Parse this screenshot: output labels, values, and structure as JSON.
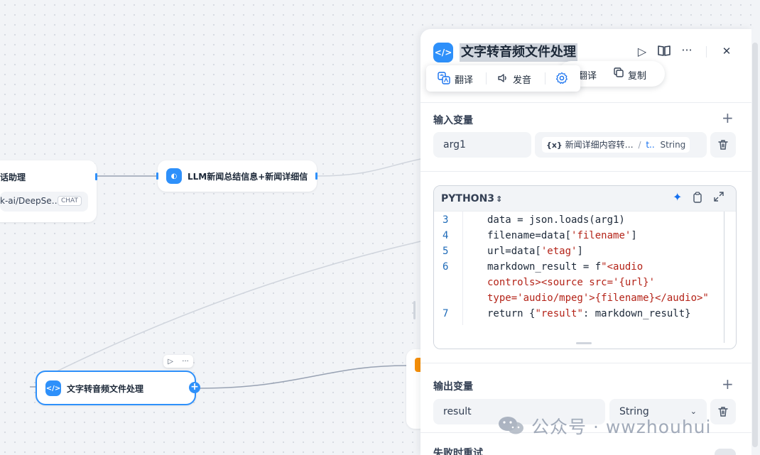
{
  "canvas": {
    "node_left": {
      "title": "话助理",
      "model": "k-ai/DeepSe…",
      "badge": "CHAT"
    },
    "node_llm": {
      "title": "LLM新闻总结信息+新闻详细信",
      "icon": "llm-icon"
    },
    "node_code": {
      "title": "文字转音频文件处理",
      "icon": "code-icon"
    },
    "mini_toolbar": {
      "run": "▷",
      "more": "···"
    },
    "plus": "+"
  },
  "panel": {
    "title": "文字转音频文件处理",
    "icon": "</>",
    "header_buttons": {
      "run": "▷",
      "docs": "📖",
      "more": "···",
      "close": "✕"
    },
    "input_section": {
      "label": "输入变量",
      "add": "+",
      "rows": [
        {
          "name": "arg1",
          "var_prefix": "{x}",
          "var_name": "新闻详细内容转…",
          "var_sep": "/",
          "var_field": "t..",
          "var_type": "String"
        }
      ]
    },
    "code": {
      "language": "PYTHON3",
      "lang_chevron": "⌃",
      "lines": [
        {
          "num": "3",
          "text": "data = json.loads(arg1)"
        },
        {
          "num": "4",
          "text_a": "filename=data[",
          "str_a": "'filename'",
          "text_b": "]"
        },
        {
          "num": "5",
          "text_a": "url=data[",
          "str_a": "'etag'",
          "text_b": "]"
        },
        {
          "num": "6",
          "text_a": "markdown_result = f",
          "str_a": "\"<audio"
        },
        {
          "num": "",
          "str_a": "controls><source src='{url}'"
        },
        {
          "num": "",
          "str_a": "type='audio/mpeg'>{filename}</audio>\""
        },
        {
          "num": "7",
          "text_a": "return {",
          "str_a": "\"result\"",
          "text_b": ": markdown_result}"
        }
      ]
    },
    "output_section": {
      "label": "输出变量",
      "add": "+",
      "rows": [
        {
          "name": "result",
          "type": "String"
        }
      ]
    },
    "retry_label": "失败时重试"
  },
  "popover_back": {
    "translate": "翻译",
    "copy": "复制"
  },
  "popover_front": {
    "translate": "翻译",
    "pronounce": "发音"
  },
  "watermark": "公众号 · wwzhouhui",
  "colors": {
    "accent": "#2e90fa",
    "string": "#b42318",
    "line_number": "#1d6ab8"
  }
}
